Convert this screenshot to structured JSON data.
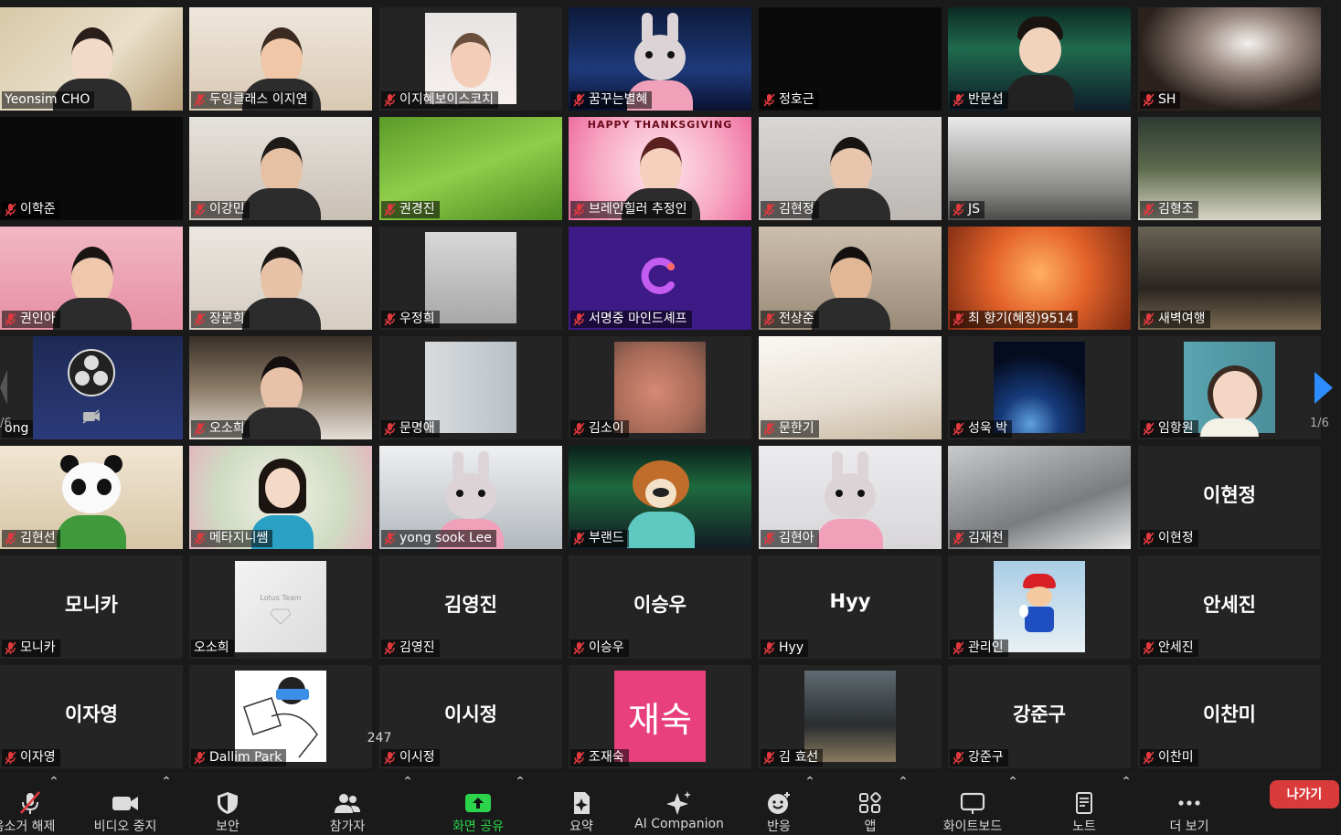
{
  "toolbar": {
    "mute_label": "음소거 해제",
    "video_label": "비디오 중지",
    "security_label": "보안",
    "participants_label": "참가자",
    "participants_count": "247",
    "share_label": "화면 공유",
    "summary_label": "요약",
    "ai_label": "AI Companion",
    "reactions_label": "반응",
    "apps_label": "앱",
    "whiteboard_label": "화이트보드",
    "notes_label": "노트",
    "more_label": "더 보기",
    "leave_label": "나가기"
  },
  "pager": {
    "right": "1/6",
    "left_partial": "/6"
  },
  "tiles": [
    {
      "name": "Yeonsim CHO",
      "muted": false,
      "initials": ""
    },
    {
      "name": "두잉클래스 이지연",
      "muted": true,
      "initials": ""
    },
    {
      "name": "이지혜보이스코치",
      "muted": true,
      "initials": ""
    },
    {
      "name": "꿈꾸는별혜",
      "muted": true,
      "initials": ""
    },
    {
      "name": "정호근",
      "muted": true,
      "initials": ""
    },
    {
      "name": "반문섭",
      "muted": true,
      "initials": ""
    },
    {
      "name": "SH",
      "muted": true,
      "initials": ""
    },
    {
      "name": "이학준",
      "muted": true,
      "initials": ""
    },
    {
      "name": "이강민",
      "muted": true,
      "initials": ""
    },
    {
      "name": "권경진",
      "muted": true,
      "initials": ""
    },
    {
      "name": "브레인힐러 추정인",
      "muted": true,
      "initials": ""
    },
    {
      "name": "김현정",
      "muted": true,
      "initials": ""
    },
    {
      "name": "JS",
      "muted": true,
      "initials": ""
    },
    {
      "name": "김형조",
      "muted": true,
      "initials": ""
    },
    {
      "name": "권인아",
      "muted": true,
      "initials": ""
    },
    {
      "name": "장문희",
      "muted": true,
      "initials": ""
    },
    {
      "name": "우정희",
      "muted": true,
      "initials": ""
    },
    {
      "name": "서명중 마인드셰프",
      "muted": true,
      "initials": ""
    },
    {
      "name": "전상준",
      "muted": true,
      "initials": ""
    },
    {
      "name": "최 향기(혜정)9514",
      "muted": true,
      "initials": ""
    },
    {
      "name": "새벽여행",
      "muted": true,
      "initials": ""
    },
    {
      "name": "ong",
      "muted": false,
      "initials": ""
    },
    {
      "name": "오소희",
      "muted": true,
      "initials": ""
    },
    {
      "name": "문명애",
      "muted": true,
      "initials": ""
    },
    {
      "name": "김소이",
      "muted": true,
      "initials": ""
    },
    {
      "name": "문한기",
      "muted": true,
      "initials": ""
    },
    {
      "name": "성욱 박",
      "muted": true,
      "initials": ""
    },
    {
      "name": "임항원",
      "muted": true,
      "initials": ""
    },
    {
      "name": "김현선",
      "muted": true,
      "initials": ""
    },
    {
      "name": "메타지니쌤",
      "muted": true,
      "initials": ""
    },
    {
      "name": "yong sook Lee",
      "muted": true,
      "initials": ""
    },
    {
      "name": "부랜드",
      "muted": true,
      "initials": ""
    },
    {
      "name": "김현아",
      "muted": true,
      "initials": ""
    },
    {
      "name": "김재천",
      "muted": true,
      "initials": ""
    },
    {
      "name": "이현정",
      "muted": true,
      "initials": "이현정"
    },
    {
      "name": "모니카",
      "muted": true,
      "initials": "모니카"
    },
    {
      "name": "오소희",
      "muted": false,
      "initials": ""
    },
    {
      "name": "김영진",
      "muted": true,
      "initials": "김영진"
    },
    {
      "name": "이승우",
      "muted": true,
      "initials": "이승우"
    },
    {
      "name": "Hyy",
      "muted": true,
      "initials": "Hyy"
    },
    {
      "name": "관리인",
      "muted": true,
      "initials": ""
    },
    {
      "name": "안세진",
      "muted": true,
      "initials": "안세진"
    },
    {
      "name": "이자영",
      "muted": true,
      "initials": "이자영"
    },
    {
      "name": "Dallim Park",
      "muted": true,
      "initials": ""
    },
    {
      "name": "이시정",
      "muted": true,
      "initials": "이시정"
    },
    {
      "name": "조재숙",
      "muted": true,
      "initials": ""
    },
    {
      "name": "김 효선",
      "muted": true,
      "initials": ""
    },
    {
      "name": "강준구",
      "muted": true,
      "initials": "강준구"
    },
    {
      "name": "이찬미",
      "muted": true,
      "initials": "이찬미"
    }
  ],
  "thumb_texts": {
    "lotus": "Lotus Team",
    "jaesuk": "재숙",
    "happy": "HAPPY THANKSGIVING"
  },
  "colors": {
    "active_speaker": "#e8e24a",
    "muted_icon": "#e0393e",
    "share_green": "#2bd44a",
    "leave_red": "#d93b3b",
    "pager_arrow": "#2d8cff"
  }
}
